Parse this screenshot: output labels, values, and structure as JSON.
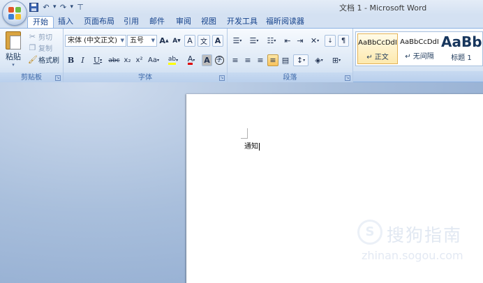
{
  "window": {
    "title": "文档 1 - Microsoft Word"
  },
  "quick_access": {
    "customize": "⊤"
  },
  "tabs": [
    {
      "label": "开始",
      "active": true
    },
    {
      "label": "插入"
    },
    {
      "label": "页面布局"
    },
    {
      "label": "引用"
    },
    {
      "label": "邮件"
    },
    {
      "label": "审阅"
    },
    {
      "label": "视图"
    },
    {
      "label": "开发工具"
    },
    {
      "label": "福昕阅读器"
    }
  ],
  "clipboard": {
    "label": "剪贴板",
    "paste": "粘贴",
    "cut": "剪切",
    "copy": "复制",
    "format_painter": "格式刷"
  },
  "font": {
    "label": "字体",
    "font_name": "宋体 (中文正文)",
    "font_size": "五号",
    "bold": "B",
    "italic": "I",
    "underline": "U",
    "strike": "abc",
    "subscript": "x₂",
    "superscript": "x²",
    "change_case": "Aa",
    "highlight": "ab",
    "font_color": "A",
    "char_shading": "A",
    "enclose": "字",
    "grow": "A",
    "shrink": "A",
    "clear": "A",
    "phonetic": "文",
    "border": "A"
  },
  "paragraph": {
    "label": "段落"
  },
  "styles": {
    "items": [
      {
        "sample": "AaBbCcDdI",
        "name": "↵ 正文",
        "selected": true
      },
      {
        "sample": "AaBbCcDdI",
        "name": "↵ 无间隔"
      },
      {
        "sample": "AaBb",
        "name": "标题 1"
      }
    ]
  },
  "document": {
    "text": "通知"
  },
  "watermark": {
    "glyph": "S",
    "cn": "搜狗指南",
    "url": "zhinan.sogou.com"
  },
  "colors": {
    "accent_border": "#8db2e3",
    "ribbon_label": "#3e6aaa",
    "active_button": "#f8c15a"
  }
}
